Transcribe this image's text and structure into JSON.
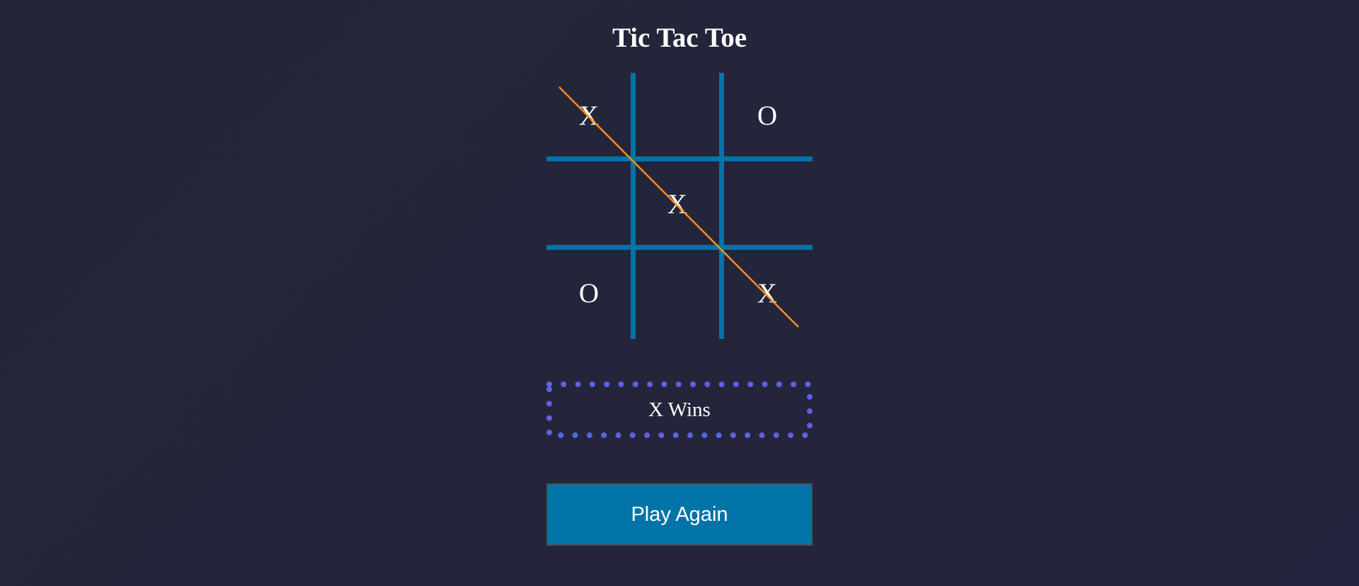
{
  "game": {
    "title": "Tic Tac Toe",
    "board": [
      "X",
      "",
      "O",
      "",
      "X",
      "",
      "O",
      "",
      "X"
    ],
    "status": "X Wins",
    "play_again_label": "Play Again",
    "winning_line": "diagonal-top-left-to-bottom-right"
  },
  "colors": {
    "background": "#24263b",
    "grid": "#0274a7",
    "win_line": "#f0921e",
    "status_border": "#5b62e6",
    "button": "#0274a7",
    "text": "#ffffff"
  }
}
